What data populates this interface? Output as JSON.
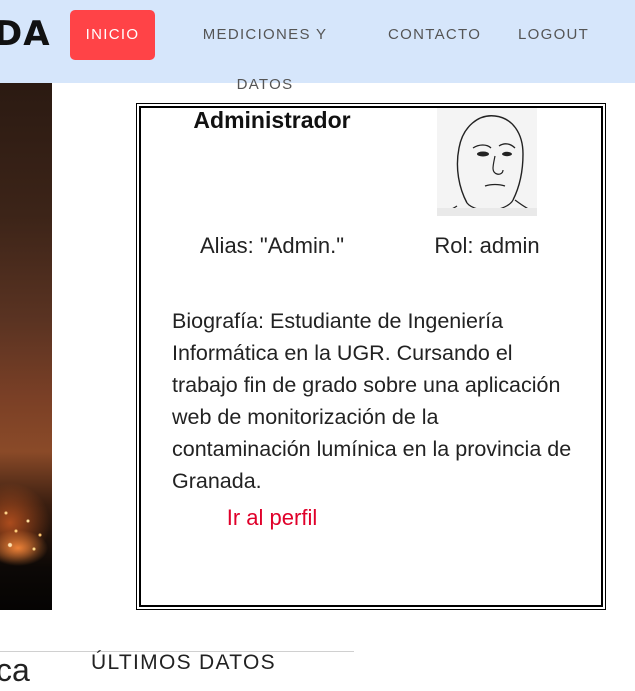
{
  "navbar": {
    "brand": "DA",
    "links": [
      {
        "label": "INICIO",
        "active": true
      },
      {
        "label": "MEDICIONES Y DATOS",
        "active": false
      },
      {
        "label": "CONTACTO",
        "active": false
      },
      {
        "label": "LOGOUT",
        "active": false
      }
    ],
    "active_color": "#ff4347",
    "background": "#d6e6fb"
  },
  "profile": {
    "name": "Administrador",
    "alias": "Alias: \"Admin.\"",
    "role": "Rol: admin",
    "bio": "Biografía: Estudiante de Ingeniería Informática en la UGR. Cursando el trabajo fin de grado sobre una aplicación web de monitorización de la contaminación lumínica en la provincia de Granada.",
    "link_label": "Ir al perfil",
    "link_color": "#e0002a",
    "avatar_icon": "wojak-face-drawing"
  },
  "bottom": {
    "left_fragment": "ca",
    "section_title": "ÚLTIMOS DATOS"
  }
}
